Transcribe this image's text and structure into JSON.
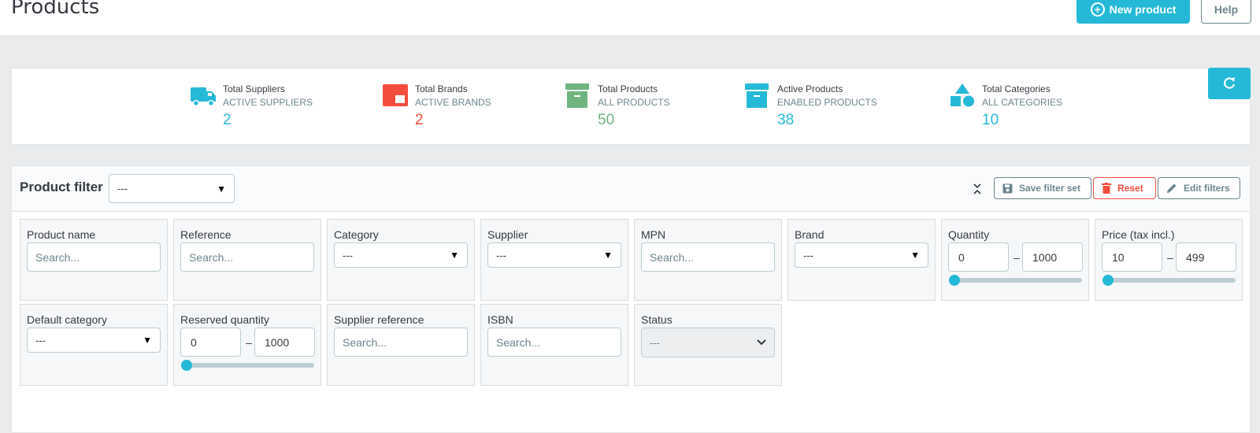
{
  "header": {
    "title": "Products",
    "new_product_label": "New product",
    "help_label": "Help"
  },
  "kpis": [
    {
      "title": "Total Suppliers",
      "subtitle": "ACTIVE SUPPLIERS",
      "value": "2",
      "icon": "truck-icon",
      "color": "#25b9d7"
    },
    {
      "title": "Total Brands",
      "subtitle": "ACTIVE BRANDS",
      "value": "2",
      "icon": "brand-icon",
      "color": "#f54c3e"
    },
    {
      "title": "Total Products",
      "subtitle": "ALL PRODUCTS",
      "value": "50",
      "icon": "archive-icon",
      "color": "#70b580"
    },
    {
      "title": "Active Products",
      "subtitle": "ENABLED PRODUCTS",
      "value": "38",
      "icon": "archive-icon",
      "color": "#25b9d7"
    },
    {
      "title": "Total Categories",
      "subtitle": "ALL CATEGORIES",
      "value": "10",
      "icon": "shapes-icon",
      "color": "#25b9d7"
    }
  ],
  "filter": {
    "title": "Product filter",
    "filter_set_value": "---",
    "save_label": "Save filter set",
    "reset_label": "Reset",
    "edit_label": "Edit filters",
    "fields": {
      "product_name": {
        "label": "Product name",
        "placeholder": "Search..."
      },
      "reference": {
        "label": "Reference",
        "placeholder": "Search..."
      },
      "category": {
        "label": "Category",
        "value": "---"
      },
      "supplier": {
        "label": "Supplier",
        "value": "---"
      },
      "mpn": {
        "label": "MPN",
        "placeholder": "Search..."
      },
      "brand": {
        "label": "Brand",
        "value": "---"
      },
      "quantity": {
        "label": "Quantity",
        "min": "0",
        "max": "1000",
        "slider_position": 0
      },
      "price": {
        "label": "Price (tax incl.)",
        "min": "10",
        "max": "499",
        "slider_position": 0
      },
      "default_category": {
        "label": "Default category",
        "value": "---"
      },
      "reserved_quantity": {
        "label": "Reserved quantity",
        "min": "0",
        "max": "1000",
        "slider_position": 0
      },
      "supplier_reference": {
        "label": "Supplier reference",
        "placeholder": "Search..."
      },
      "isbn": {
        "label": "ISBN",
        "placeholder": "Search..."
      },
      "status": {
        "label": "Status",
        "value": "---"
      }
    },
    "range_separator": "–"
  },
  "colors": {
    "primary": "#25b9d7",
    "danger": "#f54c3e",
    "success": "#70b580",
    "secondary": "#6c868e"
  }
}
